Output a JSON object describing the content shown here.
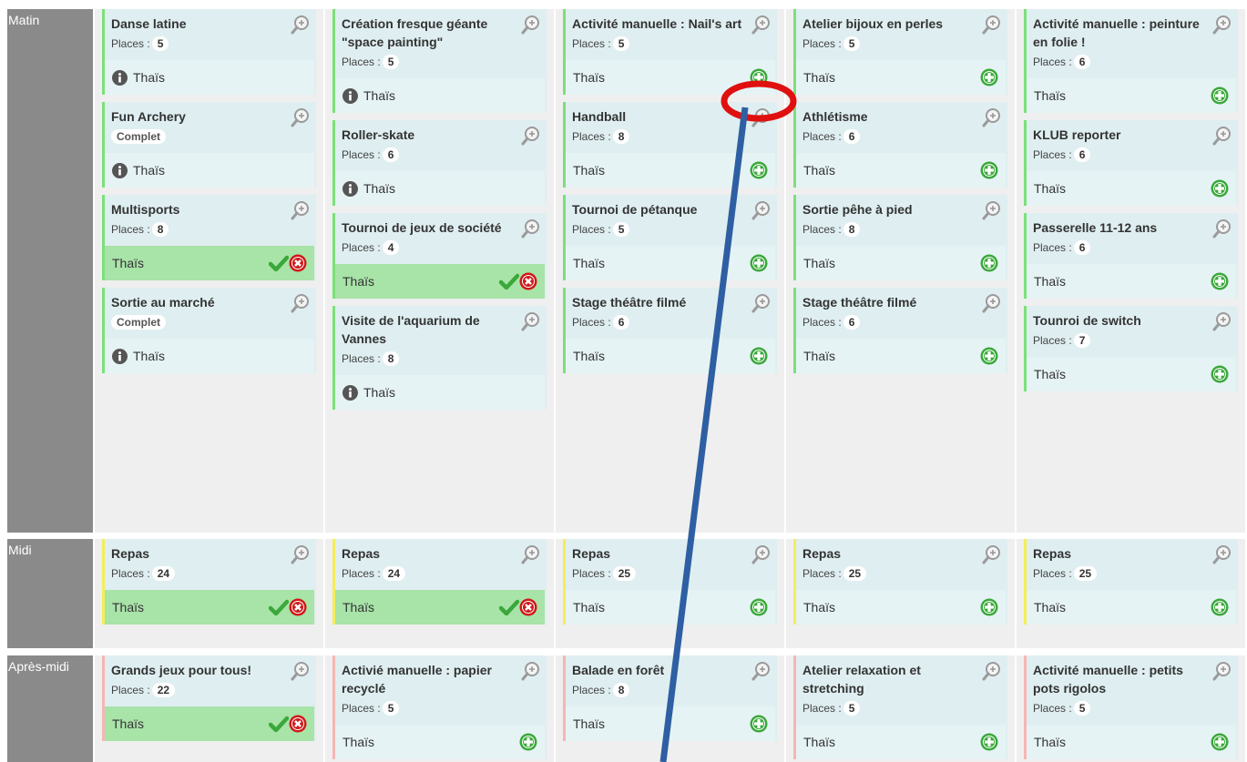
{
  "periods": {
    "matin": "Matin",
    "midi": "Midi",
    "apres_midi": "Après-midi"
  },
  "places_label": "Places :",
  "complet_label": "Complet",
  "participant": "Thaïs",
  "colors": {
    "matin_border": "#7be07b",
    "midi_border": "#f3ee5a",
    "apres_midi_border": "#f6b5b5",
    "selected_bg": "#a8e3a8",
    "add_icon": "#3aa83a",
    "remove_icon": "#d01818",
    "annotation_circle": "#e01010",
    "annotation_line": "#2e5fa3"
  },
  "matin": {
    "col1": [
      {
        "title": "Danse latine",
        "places": "5",
        "state": "info"
      },
      {
        "title": "Fun Archery",
        "complet": true,
        "state": "info"
      },
      {
        "title": "Multisports",
        "places": "8",
        "state": "selected"
      },
      {
        "title": "Sortie au marché",
        "complet": true,
        "state": "info"
      }
    ],
    "col2": [
      {
        "title": "Création fresque géante \"space painting\"",
        "places": "5",
        "state": "info"
      },
      {
        "title": "Roller-skate",
        "places": "6",
        "state": "info"
      },
      {
        "title": "Tournoi de jeux de société",
        "places": "4",
        "state": "selected"
      },
      {
        "title": "Visite de l'aquarium de Vannes",
        "places": "8",
        "state": "info"
      }
    ],
    "col3": [
      {
        "title": "Activité manuelle : Nail's art",
        "places": "5",
        "state": "add"
      },
      {
        "title": "Handball",
        "places": "8",
        "state": "add"
      },
      {
        "title": "Tournoi de pétanque",
        "places": "5",
        "state": "add"
      },
      {
        "title": "Stage théâtre filmé",
        "places": "6",
        "state": "add"
      }
    ],
    "col4": [
      {
        "title": "Atelier bijoux en perles",
        "places": "5",
        "state": "add"
      },
      {
        "title": "Athlétisme",
        "places": "6",
        "state": "add"
      },
      {
        "title": "Sortie pêhe à pied",
        "places": "8",
        "state": "add"
      },
      {
        "title": "Stage théâtre filmé",
        "places": "6",
        "state": "add"
      }
    ],
    "col5": [
      {
        "title": "Activité manuelle : peinture en folie !",
        "places": "6",
        "state": "add"
      },
      {
        "title": "KLUB reporter",
        "places": "6",
        "state": "add"
      },
      {
        "title": "Passerelle 11-12 ans",
        "places": "6",
        "state": "add"
      },
      {
        "title": "Tounroi de switch",
        "places": "7",
        "state": "add"
      }
    ]
  },
  "midi": [
    {
      "title": "Repas",
      "places": "24",
      "state": "selected"
    },
    {
      "title": "Repas",
      "places": "24",
      "state": "selected"
    },
    {
      "title": "Repas",
      "places": "25",
      "state": "add"
    },
    {
      "title": "Repas",
      "places": "25",
      "state": "add"
    },
    {
      "title": "Repas",
      "places": "25",
      "state": "add"
    }
  ],
  "apres_midi": [
    {
      "title": "Grands jeux pour tous!",
      "places": "22",
      "state": "selected"
    },
    {
      "title": "Activié manuelle : papier recyclé",
      "places": "5",
      "state": "add"
    },
    {
      "title": "Balade en forêt",
      "places": "8",
      "state": "add"
    },
    {
      "title": "Atelier relaxation et stretching",
      "places": "5",
      "state": "add"
    },
    {
      "title": "Activité manuelle : petits pots rigolos",
      "places": "5",
      "state": "add"
    }
  ]
}
